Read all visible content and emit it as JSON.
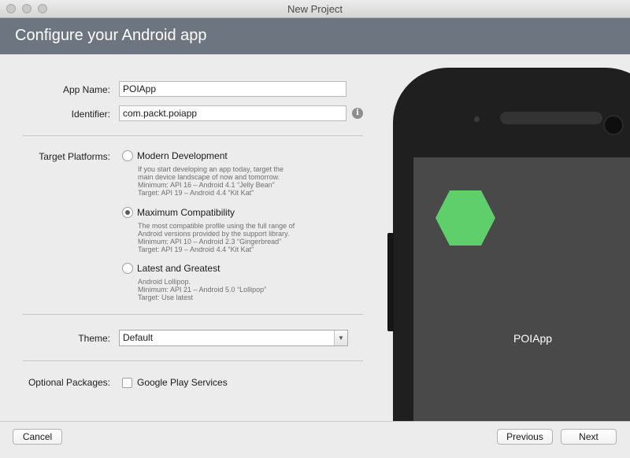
{
  "window": {
    "title": "New Project"
  },
  "header": {
    "title": "Configure your Android app"
  },
  "form": {
    "app_name": {
      "label": "App Name:",
      "value": "POIApp"
    },
    "identifier": {
      "label": "Identifier:",
      "value": "com.packt.poiapp",
      "info_icon": "info-icon"
    },
    "target_platforms": {
      "label": "Target Platforms:",
      "selected": "Maximum Compatibility",
      "options": [
        {
          "title": "Modern Development",
          "desc": [
            "If you start developing an app today, target the",
            "main device landscape of now and tomorrow.",
            "Minimum: API 16 – Android 4.1 “Jelly Bean”",
            "Target: API 19 – Android 4.4 “Kit Kat”"
          ]
        },
        {
          "title": "Maximum Compatibility",
          "desc": [
            "The most compatible profile using the full range of",
            "Android versions provided by the support library.",
            "Minimum: API 10 – Android 2.3 “Gingerbread”",
            "Target: API 19 – Android 4.4 “Kit Kat”"
          ]
        },
        {
          "title": "Latest and Greatest",
          "desc": [
            "Android Lollipop.",
            "Minimum: API 21 – Android 5.0 “Lollipop”",
            "Target: Use latest"
          ]
        }
      ]
    },
    "theme": {
      "label": "Theme:",
      "value": "Default"
    },
    "optional_packages": {
      "label": "Optional Packages:",
      "checkbox_label": "Google Play Services",
      "checked": false
    }
  },
  "preview": {
    "app_name": "POIApp",
    "app_icon_color": "#5fcf6b"
  },
  "footer": {
    "cancel": "Cancel",
    "previous": "Previous",
    "next": "Next"
  }
}
